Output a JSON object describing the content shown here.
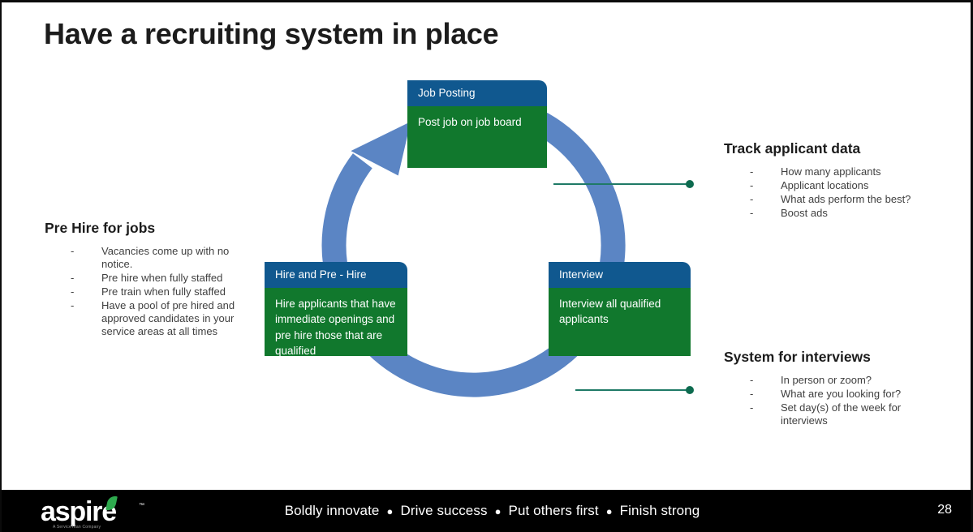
{
  "slide": {
    "title": "Have a recruiting system in place",
    "page_number": "28"
  },
  "cycle": {
    "boxes": [
      {
        "id": "job-posting",
        "header": "Job Posting",
        "body": "Post job on job board"
      },
      {
        "id": "hire-and-pre-hire",
        "header": "Hire and Pre - Hire",
        "body": "Hire applicants that have immediate openings and pre hire those that are qualified"
      },
      {
        "id": "interview",
        "header": "Interview",
        "body": "Interview all qualified applicants"
      }
    ],
    "arrow_color": "#5b85c4",
    "header_color": "#10588f",
    "body_color": "#11782d",
    "connector_color": "#1f7a66"
  },
  "callouts": {
    "pre_hire": {
      "heading": "Pre Hire for jobs",
      "bullets": [
        "Vacancies come up with no notice.",
        "Pre hire when fully staffed",
        "Pre train when fully staffed",
        "Have a pool of pre hired and approved candidates in your service areas at all times"
      ]
    },
    "track": {
      "heading": "Track applicant data",
      "bullets": [
        "How many applicants",
        "Applicant locations",
        "What ads perform the best?",
        "Boost ads"
      ]
    },
    "system": {
      "heading": "System for interviews",
      "bullets": [
        "In person or zoom?",
        "What are you looking for?",
        "Set day(s) of the week for interviews"
      ]
    },
    "bullet_marker": "-"
  },
  "footer": {
    "logo_word": "aspire",
    "logo_tm": "™",
    "logo_subtitle": "A ServiceTitan Company",
    "tagline_parts": [
      "Boldly innovate",
      "Drive success",
      "Put others first",
      "Finish strong"
    ],
    "separator": "●",
    "background": "#000000"
  }
}
